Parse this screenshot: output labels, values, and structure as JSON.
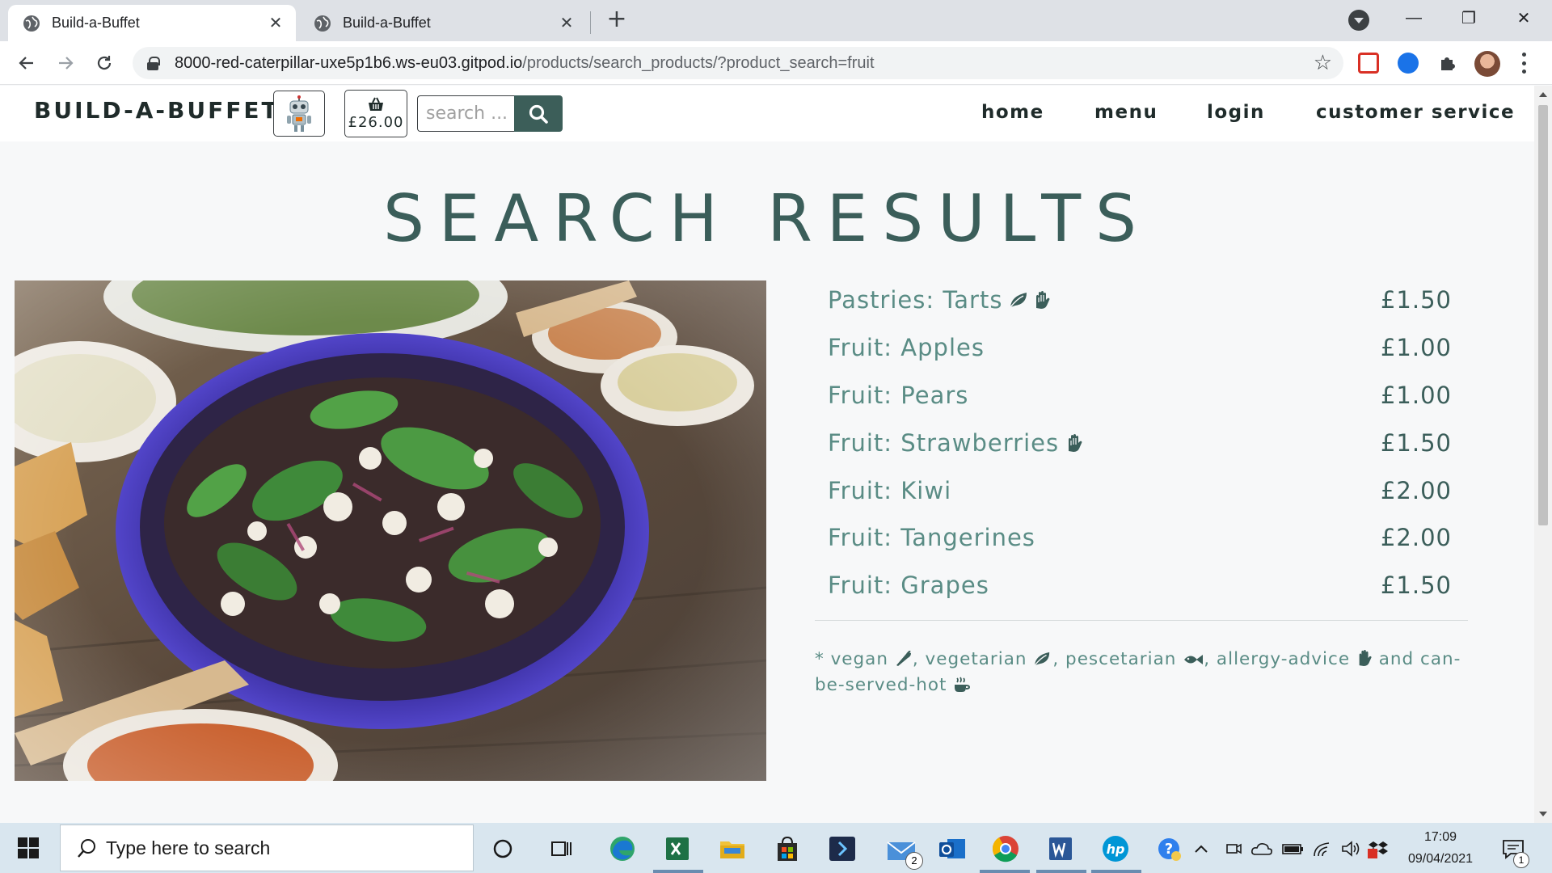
{
  "browser": {
    "tabs": [
      {
        "title": "Build-a-Buffet",
        "close": "✕"
      },
      {
        "title": "Build-a-Buffet",
        "close": "✕"
      }
    ],
    "new_tab": "+",
    "window": {
      "minimize": "—",
      "restore": "❐",
      "close": "✕"
    },
    "url_host": "8000-red-caterpillar-uxe5p1b6.ws-eu03.gitpod.io",
    "url_path": "/products/search_products/?product_search=fruit"
  },
  "site": {
    "brand": "BUILD-A-BUFFET",
    "basket_total": "£26.00",
    "search_placeholder": "search ...",
    "nav": [
      "home",
      "menu",
      "login",
      "customer service"
    ]
  },
  "page": {
    "title": "SEARCH RESULTS",
    "hero_alt": "salad bowl with spinach, feta and dips",
    "results": [
      {
        "name": "Pastries: Tarts",
        "price": "£1.50",
        "icons": [
          "vegetarian-icon",
          "allergy-advice-icon"
        ]
      },
      {
        "name": "Fruit: Apples",
        "price": "£1.00",
        "icons": []
      },
      {
        "name": "Fruit: Pears",
        "price": "£1.00",
        "icons": []
      },
      {
        "name": "Fruit: Strawberries",
        "price": "£1.50",
        "icons": [
          "allergy-advice-icon"
        ]
      },
      {
        "name": "Fruit: Kiwi",
        "price": "£2.00",
        "icons": []
      },
      {
        "name": "Fruit: Tangerines",
        "price": "£2.00",
        "icons": []
      },
      {
        "name": "Fruit: Grapes",
        "price": "£1.50",
        "icons": []
      }
    ],
    "legend": {
      "prefix": "* vegan",
      "vegetarian": ", vegetarian",
      "pescetarian": ", pescetarian",
      "allergy": ", allergy-advice",
      "hot": "and can-be-served-hot"
    }
  },
  "taskbar": {
    "search_placeholder": "Type here to search",
    "mail_badge": "2",
    "time": "17:09",
    "date": "09/04/2021",
    "notification_count": "1"
  },
  "colors": {
    "accent": "#3b5e5a",
    "result_text": "#5a8c85",
    "search_button": "#3c5e59"
  }
}
